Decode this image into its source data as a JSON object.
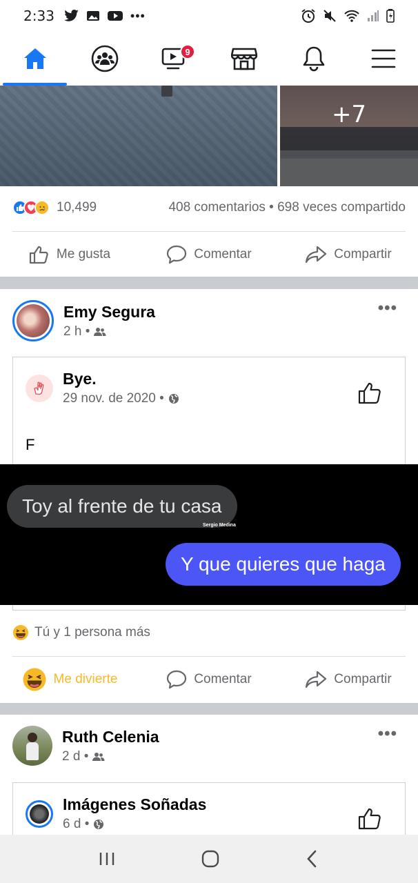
{
  "status_bar": {
    "time": "2:33",
    "left_icons": [
      "twitter-icon",
      "gallery-icon",
      "youtube-icon",
      "more-dots-icon"
    ],
    "right_icons": [
      "alarm-icon",
      "mute-icon",
      "wifi-icon",
      "signal-icon",
      "battery-icon"
    ]
  },
  "nav": {
    "items": [
      {
        "name": "home",
        "icon": "home-icon",
        "active": true
      },
      {
        "name": "groups",
        "icon": "groups-icon"
      },
      {
        "name": "watch",
        "icon": "watch-icon",
        "badge": "9"
      },
      {
        "name": "marketplace",
        "icon": "marketplace-icon"
      },
      {
        "name": "notifications",
        "icon": "bell-icon"
      },
      {
        "name": "menu",
        "icon": "menu-icon"
      }
    ],
    "watch_badge": "9"
  },
  "post1": {
    "photo_more": "+7",
    "reactions": [
      "like",
      "love",
      "sad"
    ],
    "reaction_count": "10,499",
    "comments_shares": "408 comentarios • 698 veces compartido",
    "actions": {
      "like": "Me gusta",
      "comment": "Comentar",
      "share": "Compartir"
    }
  },
  "post2": {
    "author": "Emy Segura",
    "time": "2 h •",
    "shared": {
      "page_name": "Bye.",
      "date": "29 nov. de 2020 •",
      "text": "F"
    },
    "chat": {
      "incoming": "Toy al frente de tu casa",
      "watermark": "Sergio Medina",
      "outgoing": "Y que quieres que haga"
    },
    "reacted_by": "Tú y 1 persona más",
    "actions": {
      "like": "Me divierte",
      "comment": "Comentar",
      "share": "Compartir"
    }
  },
  "post3": {
    "author": "Ruth Celenia",
    "time": "2 d •",
    "shared": {
      "page_name": "Imágenes Soñadas",
      "date": "6 d •"
    }
  },
  "colors": {
    "facebook_blue": "#1877f2",
    "haha_yellow": "#f7b928",
    "badge_red": "#e41e3f",
    "outgoing_bubble": "#4c55f5"
  }
}
